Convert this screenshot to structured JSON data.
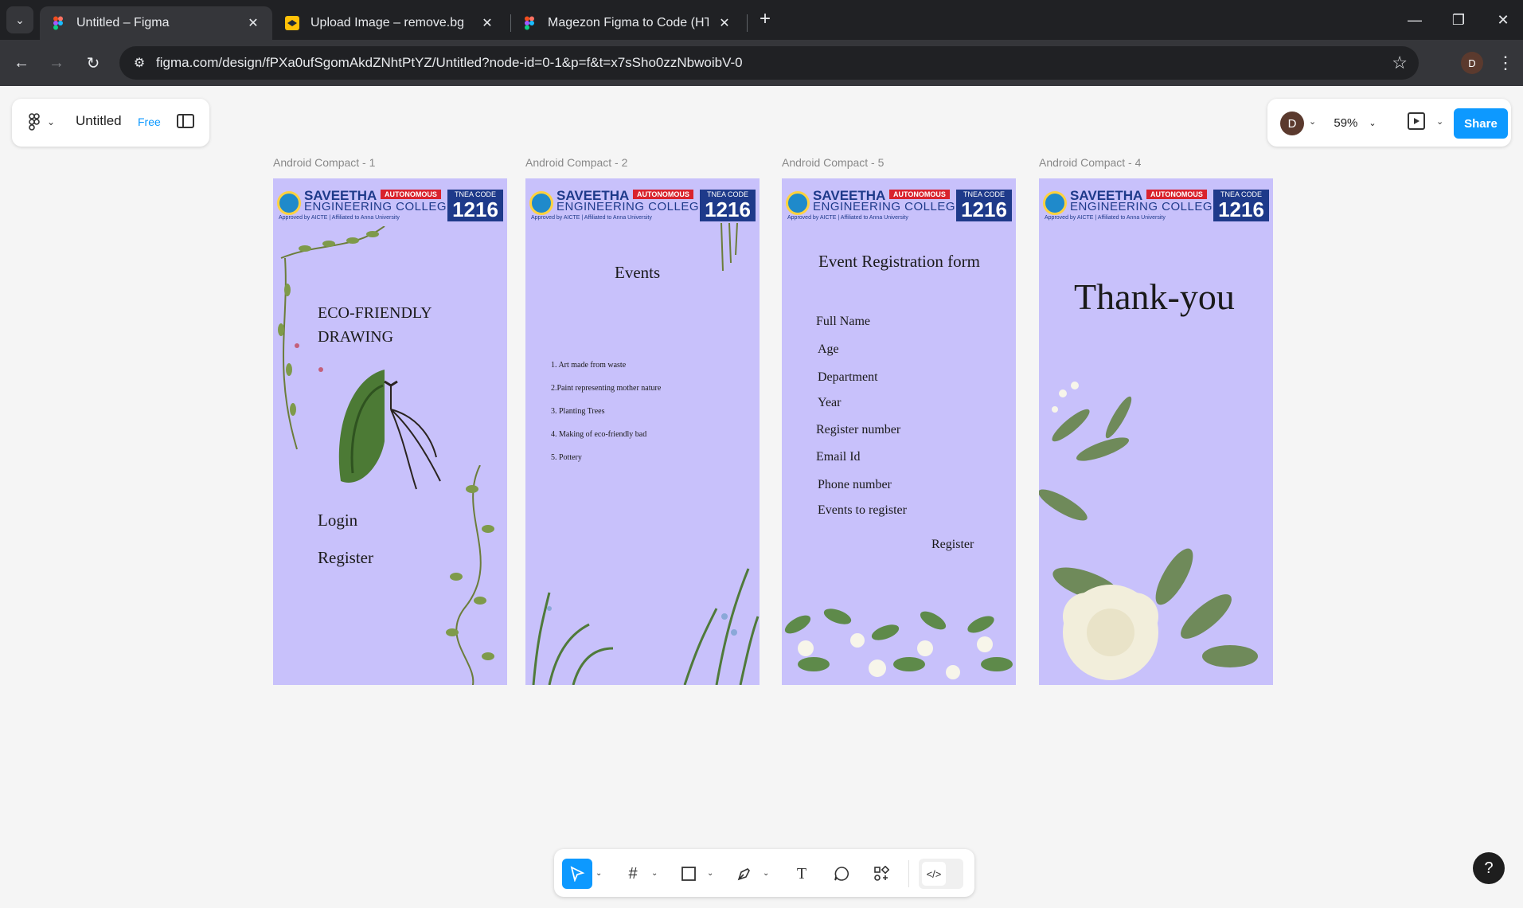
{
  "browser": {
    "tabs": [
      {
        "title": "Untitled – Figma",
        "active": true
      },
      {
        "title": "Upload Image – remove.bg",
        "active": false
      },
      {
        "title": "Magezon Figma to Code (HTML",
        "active": false
      }
    ],
    "url": "figma.com/design/fPXa0ufSgomAkdZNhtPtYZ/Untitled?node-id=0-1&p=f&t=x7sSho0zzNbwoibV-0",
    "profile_initial": "D"
  },
  "figma": {
    "file_name": "Untitled",
    "plan": "Free",
    "user_initial": "D",
    "zoom": "59%",
    "share_label": "Share",
    "help_label": "?"
  },
  "frames": [
    {
      "label": "Android Compact - 1",
      "title_line1": "ECO-FRIENDLY",
      "title_line2": "DRAWING",
      "login": "Login",
      "register": "Register"
    },
    {
      "label": "Android Compact - 2",
      "title": "Events",
      "items": [
        "1. Art made from waste",
        "2.Paint representing mother nature",
        "3. Planting Trees",
        "4. Making of eco-friendly bad",
        "5. Pottery"
      ]
    },
    {
      "label": "Android Compact - 5",
      "title": "Event Registration form",
      "fields": [
        "Full Name",
        "Age",
        "Department",
        "Year",
        "Register number",
        "Email Id",
        "Phone number",
        "Events to register"
      ],
      "register": "Register"
    },
    {
      "label": "Android Compact - 4",
      "title": "Thank-you"
    }
  ],
  "banner": {
    "name_line1": "SAVEETHA",
    "name_line2": "ENGINEERING COLLEGE",
    "autonomous": "AUTONOMOUS",
    "approved": "Approved by AICTE  |  Affiliated to Anna University",
    "tnea_label": "TNEA CODE",
    "tnea_code": "1216"
  },
  "colors": {
    "frame_bg": "#c8c1fb",
    "accent": "#0d99ff"
  }
}
